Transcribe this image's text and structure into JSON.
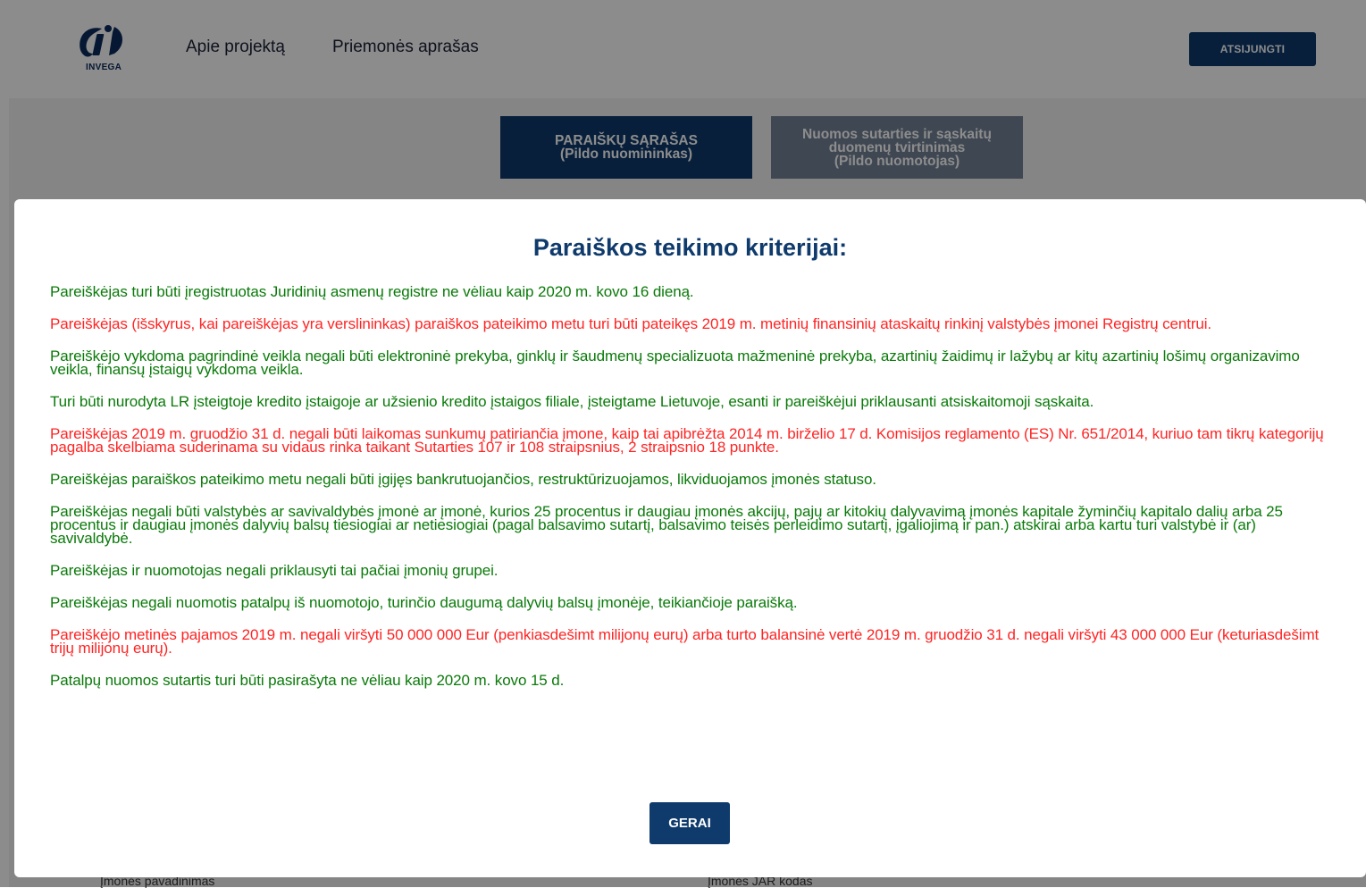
{
  "header": {
    "logo_text": "INVEGA",
    "nav": [
      "Apie projektą",
      "Priemonės aprašas"
    ],
    "logout_label": "ATSIJUNGTI"
  },
  "tabs": [
    {
      "line1": "PARAIŠKŲ SĄRAŠAS",
      "line2": "(Pildo nuomininkas)"
    },
    {
      "line1": "Nuomos sutarties ir sąskaitų",
      "line2": "duomenų tvirtinimas",
      "line3": "(Pildo nuomotojas)"
    }
  ],
  "background_labels": [
    "Įmonės pavadinimas",
    "Įmonės JAR kodas"
  ],
  "modal": {
    "title": "Paraiškos teikimo kriterijai:",
    "criteria": [
      {
        "text": "Pareiškėjas turi būti įregistruotas Juridinių asmenų registre ne vėliau kaip 2020 m. kovo 16 dieną.",
        "status": "ok"
      },
      {
        "text": "Pareiškėjas (išskyrus, kai pareiškėjas yra verslininkas) paraiškos pateikimo metu turi būti pateikęs 2019 m. metinių finansinių ataskaitų rinkinį valstybės įmonei Registrų centrui.",
        "status": "fail"
      },
      {
        "text": "Pareiškėjo vykdoma pagrindinė veikla negali būti elektroninė prekyba, ginklų ir šaudmenų specializuota mažmeninė prekyba, azartinių žaidimų ir lažybų ar kitų azartinių lošimų organizavimo veikla, finansų įstaigų vykdoma veikla.",
        "status": "ok"
      },
      {
        "text": "Turi būti nurodyta LR įsteigtoje kredito įstaigoje ar užsienio kredito įstaigos filiale, įsteigtame Lietuvoje, esanti ir pareiškėjui priklausanti atsiskaitomoji sąskaita.",
        "status": "ok"
      },
      {
        "text": "Pareiškėjas 2019 m. gruodžio 31 d. negali būti laikomas sunkumų patiriančia įmone, kaip tai apibrėžta 2014 m. birželio 17 d. Komisijos reglamento (ES) Nr. 651/2014, kuriuo tam tikrų kategorijų pagalba skelbiama suderinama su vidaus rinka taikant Sutarties 107 ir 108 straipsnius, 2 straipsnio 18 punkte.",
        "status": "fail"
      },
      {
        "text": "Pareiškėjas paraiškos pateikimo metu negali būti įgijęs bankrutuojančios, restruktūrizuojamos, likviduojamos įmonės statuso.",
        "status": "ok"
      },
      {
        "text": "Pareiškėjas negali būti valstybės ar savivaldybės įmonė ar įmonė, kurios 25 procentus ir daugiau įmonės akcijų, pajų ar kitokių dalyvavimą įmonės kapitale žyminčių kapitalo dalių arba 25 procentus ir daugiau įmonės dalyvių balsų tiesiogiai ar netiesiogiai (pagal balsavimo sutartį, balsavimo teisės perleidimo sutartį, įgaliojimą ir pan.) atskirai arba kartu turi valstybė ir (ar) savivaldybė.",
        "status": "ok"
      },
      {
        "text": "Pareiškėjas ir nuomotojas negali priklausyti tai pačiai įmonių grupei.",
        "status": "ok"
      },
      {
        "text": "Pareiškėjas negali nuomotis patalpų iš nuomotojo, turinčio daugumą dalyvių balsų įmonėje, teikiančioje paraišką.",
        "status": "ok"
      },
      {
        "text": "Pareiškėjo metinės pajamos 2019 m. negali viršyti 50 000 000 Eur (penkiasdešimt milijonų eurų) arba turto balansinė vertė 2019 m. gruodžio 31 d. negali viršyti 43 000 000 Eur (keturiasdešimt trijų milijonų eurų).",
        "status": "fail"
      },
      {
        "text": "Patalpų nuomos sutartis turi būti pasirašyta ne vėliau kaip 2020 m. kovo 15 d.",
        "status": "ok"
      }
    ],
    "ok_label": "GERAI"
  },
  "colors": {
    "brand": "#0e3a6c",
    "criterion_ok": "#0a7a0a",
    "criterion_fail": "#ff2424",
    "tab_inactive": "#738196"
  }
}
